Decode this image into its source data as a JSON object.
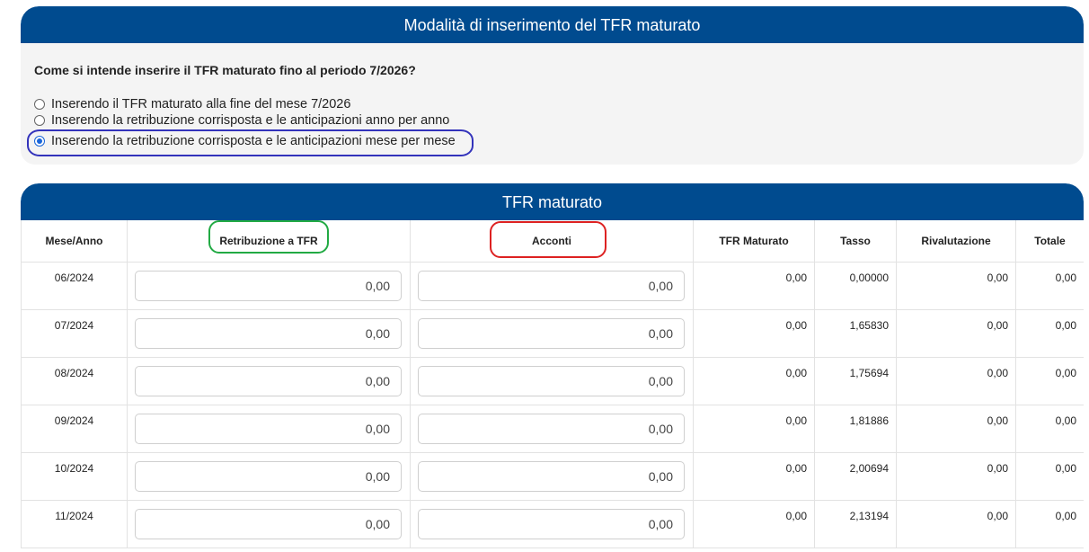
{
  "mode_panel": {
    "title": "Modalità di inserimento del TFR maturato",
    "question": "Come si intende inserire il TFR maturato fino al periodo 7/2026?",
    "options": [
      {
        "label": "Inserendo il TFR maturato alla fine del mese 7/2026",
        "checked": false
      },
      {
        "label": "Inserendo la retribuzione corrisposta e le anticipazioni anno per anno",
        "checked": false
      },
      {
        "label": "Inserendo la retribuzione corrisposta e le anticipazioni mese per mese",
        "checked": true
      }
    ],
    "highlight_color": "#3333bb"
  },
  "tfr_panel": {
    "title": "TFR maturato",
    "columns": {
      "month": "Mese/Anno",
      "salary": "Retribuzione a TFR",
      "advances": "Acconti",
      "tfr": "TFR Maturato",
      "rate": "Tasso",
      "revaluation": "Rivalutazione",
      "total": "Totale"
    },
    "highlight_colors": {
      "salary": "#22aa44",
      "advances": "#dd2222"
    },
    "rows": [
      {
        "month": "06/2024",
        "salary": "0,00",
        "advances": "0,00",
        "tfr": "0,00",
        "rate": "0,00000",
        "revaluation": "0,00",
        "total": "0,00"
      },
      {
        "month": "07/2024",
        "salary": "0,00",
        "advances": "0,00",
        "tfr": "0,00",
        "rate": "1,65830",
        "revaluation": "0,00",
        "total": "0,00"
      },
      {
        "month": "08/2024",
        "salary": "0,00",
        "advances": "0,00",
        "tfr": "0,00",
        "rate": "1,75694",
        "revaluation": "0,00",
        "total": "0,00"
      },
      {
        "month": "09/2024",
        "salary": "0,00",
        "advances": "0,00",
        "tfr": "0,00",
        "rate": "1,81886",
        "revaluation": "0,00",
        "total": "0,00"
      },
      {
        "month": "10/2024",
        "salary": "0,00",
        "advances": "0,00",
        "tfr": "0,00",
        "rate": "2,00694",
        "revaluation": "0,00",
        "total": "0,00"
      },
      {
        "month": "11/2024",
        "salary": "0,00",
        "advances": "0,00",
        "tfr": "0,00",
        "rate": "2,13194",
        "revaluation": "0,00",
        "total": "0,00"
      }
    ]
  },
  "colors": {
    "header_bg": "#004b8f",
    "panel_bg": "#f4f4f4",
    "radio_accent": "#1a66d9"
  }
}
